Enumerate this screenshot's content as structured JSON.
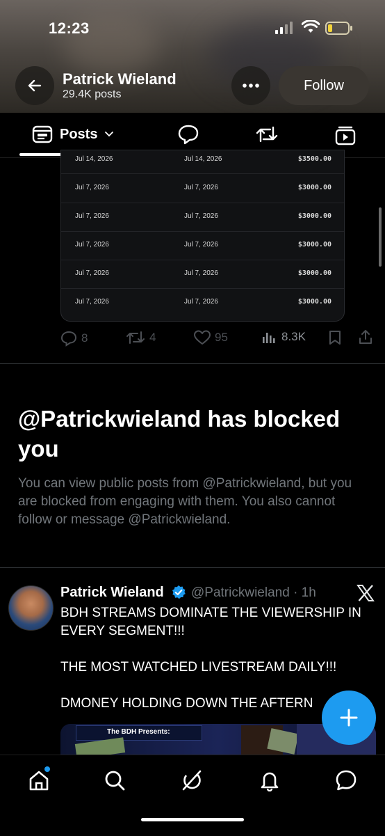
{
  "status_bar": {
    "time": "12:23"
  },
  "header": {
    "name": "Patrick Wieland",
    "posts_count": "29.4K posts",
    "follow_label": "Follow"
  },
  "tabs": {
    "active_label": "Posts"
  },
  "table": {
    "rows": [
      {
        "date1": "Jul 14, 2026",
        "date2": "Jul 14, 2026",
        "amount": "$3500.00"
      },
      {
        "date1": "Jul 7, 2026",
        "date2": "Jul 7, 2026",
        "amount": "$3000.00"
      },
      {
        "date1": "Jul 7, 2026",
        "date2": "Jul 7, 2026",
        "amount": "$3000.00"
      },
      {
        "date1": "Jul 7, 2026",
        "date2": "Jul 7, 2026",
        "amount": "$3000.00"
      },
      {
        "date1": "Jul 7, 2026",
        "date2": "Jul 7, 2026",
        "amount": "$3000.00"
      },
      {
        "date1": "Jul 7, 2026",
        "date2": "Jul 7, 2026",
        "amount": "$3000.00"
      }
    ]
  },
  "actions": {
    "replies": "8",
    "reposts": "4",
    "likes": "95",
    "views": "8.3K"
  },
  "blocked": {
    "title": "@Patrickwieland has blocked you",
    "body": "You can view public posts from @Patrickwieland, but you are blocked from engaging with them. You also cannot follow or message @Patrickwieland."
  },
  "tweet": {
    "name": "Patrick Wieland",
    "handle_time": "@Patrickwieland · 1h",
    "text": "BDH STREAMS DOMINATE THE VIEWERSHIP IN EVERY SEGMENT!!!\n\nTHE MOST WATCHED LIVESTREAM DAILY!!!\n\nDMONEY HOLDING DOWN THE AFTERN",
    "media_caption": "The BDH Presents:"
  },
  "colors": {
    "accent": "#1d9bf0",
    "background": "#000000",
    "muted": "#71767b"
  }
}
